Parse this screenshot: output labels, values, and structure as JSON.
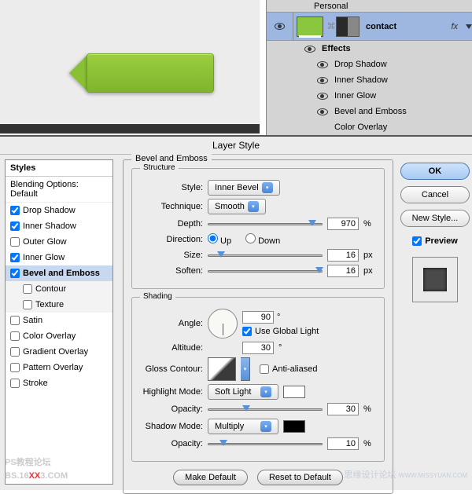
{
  "top": {
    "layer_name": "contact",
    "fx": "fx",
    "effects_label": "Effects",
    "items": [
      "Drop Shadow",
      "Inner Shadow",
      "Inner Glow",
      "Bevel and Emboss",
      "Color Overlay"
    ],
    "personal": "Personal"
  },
  "dialog_title": "Layer Style",
  "styles_header": "Styles",
  "blending": "Blending Options: Default",
  "style_rows": [
    {
      "label": "Drop Shadow",
      "checked": true
    },
    {
      "label": "Inner Shadow",
      "checked": true
    },
    {
      "label": "Outer Glow",
      "checked": false
    },
    {
      "label": "Inner Glow",
      "checked": true
    },
    {
      "label": "Bevel and Emboss",
      "checked": true,
      "selected": true
    },
    {
      "label": "Contour",
      "checked": false,
      "sub": true
    },
    {
      "label": "Texture",
      "checked": false,
      "sub": true
    },
    {
      "label": "Satin",
      "checked": false
    },
    {
      "label": "Color Overlay",
      "checked": false
    },
    {
      "label": "Gradient Overlay",
      "checked": false
    },
    {
      "label": "Pattern Overlay",
      "checked": false
    },
    {
      "label": "Stroke",
      "checked": false
    }
  ],
  "panel": {
    "title": "Bevel and Emboss",
    "structure": "Structure",
    "shading": "Shading",
    "style_lbl": "Style:",
    "style_val": "Inner Bevel",
    "tech_lbl": "Technique:",
    "tech_val": "Smooth",
    "depth_lbl": "Depth:",
    "depth_val": "970",
    "depth_unit": "%",
    "dir_lbl": "Direction:",
    "dir_up": "Up",
    "dir_down": "Down",
    "size_lbl": "Size:",
    "size_val": "16",
    "size_unit": "px",
    "soften_lbl": "Soften:",
    "soften_val": "16",
    "soften_unit": "px",
    "angle_lbl": "Angle:",
    "angle_val": "90",
    "deg": "°",
    "global": "Use Global Light",
    "alt_lbl": "Altitude:",
    "alt_val": "30",
    "gloss_lbl": "Gloss Contour:",
    "aa": "Anti-aliased",
    "hi_lbl": "Highlight Mode:",
    "hi_val": "Soft Light",
    "hi_op_lbl": "Opacity:",
    "hi_op_val": "30",
    "hi_op_unit": "%",
    "sh_lbl": "Shadow Mode:",
    "sh_val": "Multiply",
    "sh_op_lbl": "Opacity:",
    "sh_op_val": "10",
    "sh_op_unit": "%",
    "make_def": "Make Default",
    "reset_def": "Reset to Default"
  },
  "right": {
    "ok": "OK",
    "cancel": "Cancel",
    "new_style": "New Style...",
    "preview": "Preview"
  },
  "wm": {
    "a1": "PS教程论坛",
    "a2": "BS.16",
    "a3": "XX",
    "a4": "3.COM",
    "b": "思缘设计论坛",
    "b2": "WWW.MISSYUAN.COM"
  }
}
